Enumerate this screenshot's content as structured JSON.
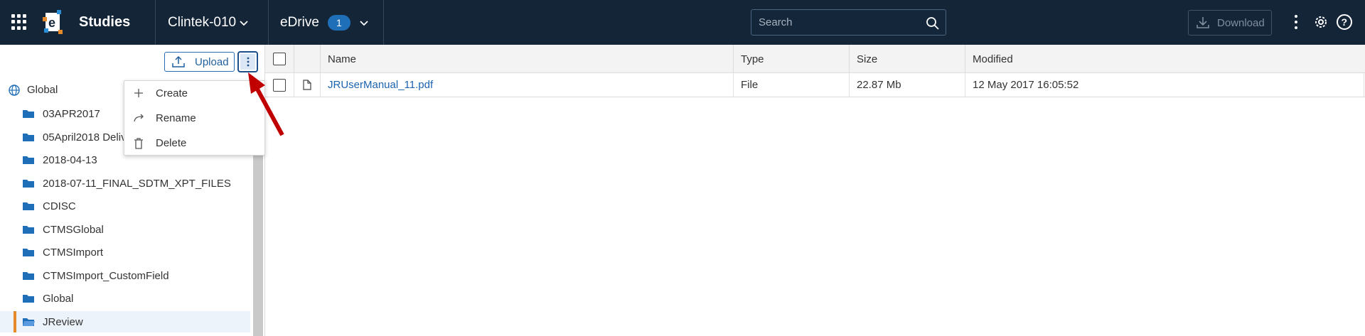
{
  "header": {
    "app_title": "Studies",
    "study_selector": "Clintek-010",
    "module_selector": "eDrive",
    "module_badge": "1",
    "search_placeholder": "Search",
    "download_label": "Download",
    "icons": [
      "apps-grid-icon",
      "app-logo",
      "chevron-down-icon",
      "search-icon",
      "download-icon",
      "kebab-icon",
      "gear-icon",
      "help-icon"
    ]
  },
  "left_panel": {
    "upload_label": "Upload",
    "tree_root": "Global",
    "folders": [
      {
        "label": "03APR2017",
        "selected": false
      },
      {
        "label": "05April2018 Deliv",
        "selected": false
      },
      {
        "label": "2018-04-13",
        "selected": false
      },
      {
        "label": "2018-07-11_FINAL_SDTM_XPT_FILES",
        "selected": false
      },
      {
        "label": "CDISC",
        "selected": false
      },
      {
        "label": "CTMSGlobal",
        "selected": false
      },
      {
        "label": "CTMSImport",
        "selected": false
      },
      {
        "label": "CTMSImport_CustomField",
        "selected": false
      },
      {
        "label": "Global",
        "selected": false
      },
      {
        "label": "JReview",
        "selected": true
      }
    ]
  },
  "context_menu": {
    "items": [
      {
        "label": "Create",
        "icon": "plus-icon"
      },
      {
        "label": "Rename",
        "icon": "rename-arrow-icon"
      },
      {
        "label": "Delete",
        "icon": "trash-icon"
      }
    ]
  },
  "table": {
    "columns": [
      "Name",
      "Type",
      "Size",
      "Modified"
    ],
    "rows": [
      {
        "name": "JRUserManual_11.pdf",
        "type": "File",
        "size": "22.87 Mb",
        "modified": "12 May 2017 16:05:52"
      }
    ]
  },
  "colors": {
    "topbar": "#142538",
    "accent_blue": "#1c63b0",
    "selected_bar": "#e58a2b",
    "annotation_arrow": "#c00000"
  }
}
